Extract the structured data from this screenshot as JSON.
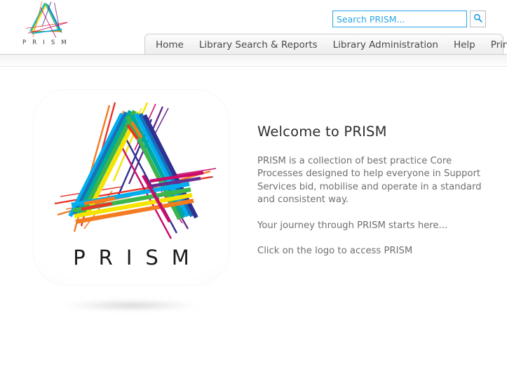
{
  "brand": {
    "wordmark": "P R I S M",
    "logo_icon": "prism-triangle-logo"
  },
  "search": {
    "placeholder": "Search PRISM...",
    "value": "",
    "button_icon": "search-icon",
    "accent_color": "#2aa7e5"
  },
  "nav": {
    "items": [
      {
        "label": "Home"
      },
      {
        "label": "Library Search & Reports"
      },
      {
        "label": "Library Administration"
      },
      {
        "label": "Help"
      },
      {
        "label": "Print"
      }
    ]
  },
  "logo_tile": {
    "wordmark": "PRISM",
    "icon": "prism-triangle-logo",
    "colors": {
      "red": "#e8352a",
      "orange": "#f47b20",
      "yellow": "#f6e400",
      "green": "#3cb54a",
      "teal": "#00a99d",
      "cyan": "#00aeef",
      "blue": "#1b6fb8",
      "indigo": "#2e3192",
      "purple": "#662d91",
      "magenta": "#ca0b6b"
    }
  },
  "welcome": {
    "title": "Welcome to PRISM",
    "paragraphs": [
      "PRISM is a collection of best practice Core Processes designed to help everyone in Support Services bid, mobilise and operate in a standard and consistent way.",
      "Your journey through PRISM starts here...",
      "Click on the logo to access PRISM"
    ]
  }
}
